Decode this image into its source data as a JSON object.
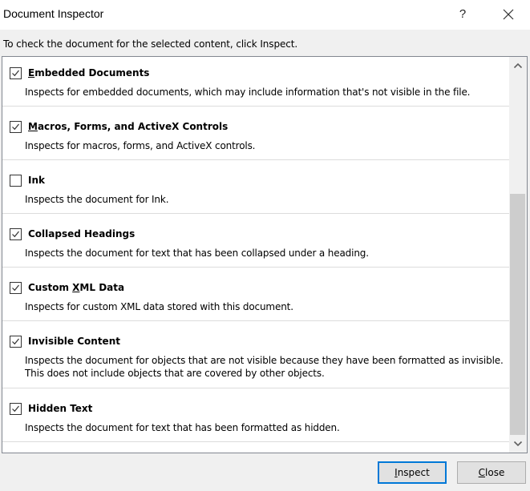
{
  "window": {
    "title": "Document Inspector",
    "help_label": "?",
    "close_icon": "close-x-icon"
  },
  "instructions": "To check the document for the selected content, click Inspect.",
  "items": [
    {
      "label_pre": "",
      "label_accel": "E",
      "label_post": "mbedded Documents",
      "checked": true,
      "description": [
        "Inspects for embedded documents, which may include information that's not visible in the file."
      ]
    },
    {
      "label_pre": "",
      "label_accel": "M",
      "label_post": "acros, Forms, and ActiveX Controls",
      "checked": true,
      "description": [
        "Inspects for macros, forms, and ActiveX controls."
      ]
    },
    {
      "label_pre": "Ink",
      "label_accel": "",
      "label_post": "",
      "checked": false,
      "description": [
        "Inspects the document for Ink."
      ]
    },
    {
      "label_pre": "Collapsed Headings",
      "label_accel": "",
      "label_post": "",
      "checked": true,
      "description": [
        "Inspects the document for text that has been collapsed under a heading."
      ]
    },
    {
      "label_pre": "Custom ",
      "label_accel": "X",
      "label_post": "ML Data",
      "checked": true,
      "description": [
        "Inspects for custom XML data stored with this document."
      ]
    },
    {
      "label_pre": "Invisible Content",
      "label_accel": "",
      "label_post": "",
      "checked": true,
      "description": [
        "Inspects the document for objects that are not visible because they have been formatted as invisible.",
        "This does not include objects that are covered by other objects."
      ]
    },
    {
      "label_pre": "Hidden Text",
      "label_accel": "",
      "label_post": "",
      "checked": true,
      "description": [
        "Inspects the document for text that has been formatted as hidden."
      ]
    }
  ],
  "scrollbar": {
    "up_icon": "chevron-up-icon",
    "down_icon": "chevron-down-icon",
    "thumb_start_fraction": 0.33,
    "thumb_size_fraction": 0.67
  },
  "buttons": {
    "inspect": {
      "pre": "",
      "accel": "I",
      "post": "nspect"
    },
    "close": {
      "pre": "",
      "accel": "C",
      "post": "lose"
    }
  },
  "colors": {
    "accent": "#0078d7",
    "button_bg": "#e1e1e1",
    "dialog_bg": "#f0f0f0",
    "thumb": "#cdcdcd"
  }
}
